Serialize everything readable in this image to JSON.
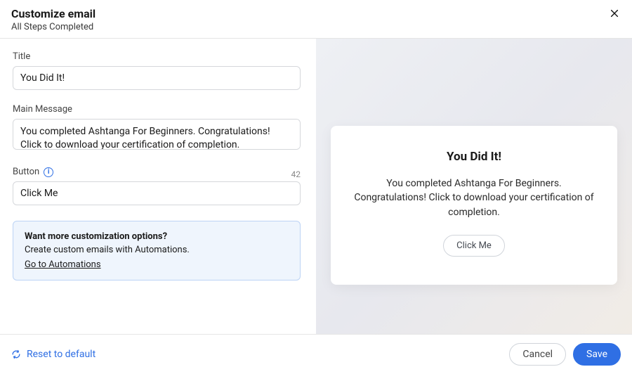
{
  "header": {
    "title": "Customize email",
    "subtitle": "All Steps Completed"
  },
  "form": {
    "title_label": "Title",
    "title_value": "You Did It!",
    "message_label": "Main Message",
    "message_value": "You completed Ashtanga For Beginners. Congratulations! Click to download your certification of completion.",
    "button_label": "Button",
    "button_char_count": "42",
    "button_value": "Click Me"
  },
  "promo": {
    "title": "Want more customization options?",
    "body": "Create custom emails with Automations.",
    "link": "Go to Automations"
  },
  "preview": {
    "title": "You Did It!",
    "body": "You completed Ashtanga For Beginners. Congratulations! Click to download your certification of completion.",
    "button": "Click Me"
  },
  "footer": {
    "reset": "Reset to default",
    "cancel": "Cancel",
    "save": "Save"
  }
}
